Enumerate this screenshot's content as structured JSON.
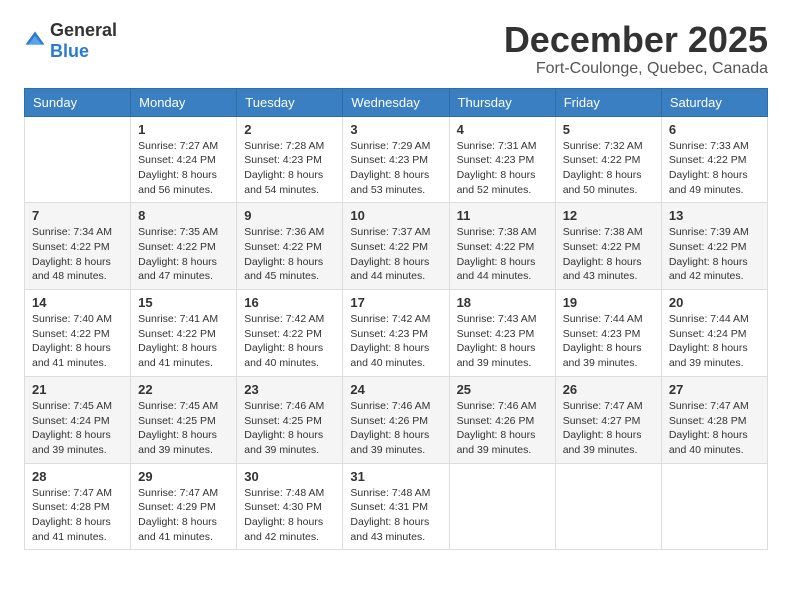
{
  "logo": {
    "general": "General",
    "blue": "Blue"
  },
  "header": {
    "month": "December 2025",
    "location": "Fort-Coulonge, Quebec, Canada"
  },
  "weekdays": [
    "Sunday",
    "Monday",
    "Tuesday",
    "Wednesday",
    "Thursday",
    "Friday",
    "Saturday"
  ],
  "weeks": [
    [
      {
        "day": "",
        "info": ""
      },
      {
        "day": "1",
        "info": "Sunrise: 7:27 AM\nSunset: 4:24 PM\nDaylight: 8 hours\nand 56 minutes."
      },
      {
        "day": "2",
        "info": "Sunrise: 7:28 AM\nSunset: 4:23 PM\nDaylight: 8 hours\nand 54 minutes."
      },
      {
        "day": "3",
        "info": "Sunrise: 7:29 AM\nSunset: 4:23 PM\nDaylight: 8 hours\nand 53 minutes."
      },
      {
        "day": "4",
        "info": "Sunrise: 7:31 AM\nSunset: 4:23 PM\nDaylight: 8 hours\nand 52 minutes."
      },
      {
        "day": "5",
        "info": "Sunrise: 7:32 AM\nSunset: 4:22 PM\nDaylight: 8 hours\nand 50 minutes."
      },
      {
        "day": "6",
        "info": "Sunrise: 7:33 AM\nSunset: 4:22 PM\nDaylight: 8 hours\nand 49 minutes."
      }
    ],
    [
      {
        "day": "7",
        "info": "Sunrise: 7:34 AM\nSunset: 4:22 PM\nDaylight: 8 hours\nand 48 minutes."
      },
      {
        "day": "8",
        "info": "Sunrise: 7:35 AM\nSunset: 4:22 PM\nDaylight: 8 hours\nand 47 minutes."
      },
      {
        "day": "9",
        "info": "Sunrise: 7:36 AM\nSunset: 4:22 PM\nDaylight: 8 hours\nand 45 minutes."
      },
      {
        "day": "10",
        "info": "Sunrise: 7:37 AM\nSunset: 4:22 PM\nDaylight: 8 hours\nand 44 minutes."
      },
      {
        "day": "11",
        "info": "Sunrise: 7:38 AM\nSunset: 4:22 PM\nDaylight: 8 hours\nand 44 minutes."
      },
      {
        "day": "12",
        "info": "Sunrise: 7:38 AM\nSunset: 4:22 PM\nDaylight: 8 hours\nand 43 minutes."
      },
      {
        "day": "13",
        "info": "Sunrise: 7:39 AM\nSunset: 4:22 PM\nDaylight: 8 hours\nand 42 minutes."
      }
    ],
    [
      {
        "day": "14",
        "info": "Sunrise: 7:40 AM\nSunset: 4:22 PM\nDaylight: 8 hours\nand 41 minutes."
      },
      {
        "day": "15",
        "info": "Sunrise: 7:41 AM\nSunset: 4:22 PM\nDaylight: 8 hours\nand 41 minutes."
      },
      {
        "day": "16",
        "info": "Sunrise: 7:42 AM\nSunset: 4:22 PM\nDaylight: 8 hours\nand 40 minutes."
      },
      {
        "day": "17",
        "info": "Sunrise: 7:42 AM\nSunset: 4:23 PM\nDaylight: 8 hours\nand 40 minutes."
      },
      {
        "day": "18",
        "info": "Sunrise: 7:43 AM\nSunset: 4:23 PM\nDaylight: 8 hours\nand 39 minutes."
      },
      {
        "day": "19",
        "info": "Sunrise: 7:44 AM\nSunset: 4:23 PM\nDaylight: 8 hours\nand 39 minutes."
      },
      {
        "day": "20",
        "info": "Sunrise: 7:44 AM\nSunset: 4:24 PM\nDaylight: 8 hours\nand 39 minutes."
      }
    ],
    [
      {
        "day": "21",
        "info": "Sunrise: 7:45 AM\nSunset: 4:24 PM\nDaylight: 8 hours\nand 39 minutes."
      },
      {
        "day": "22",
        "info": "Sunrise: 7:45 AM\nSunset: 4:25 PM\nDaylight: 8 hours\nand 39 minutes."
      },
      {
        "day": "23",
        "info": "Sunrise: 7:46 AM\nSunset: 4:25 PM\nDaylight: 8 hours\nand 39 minutes."
      },
      {
        "day": "24",
        "info": "Sunrise: 7:46 AM\nSunset: 4:26 PM\nDaylight: 8 hours\nand 39 minutes."
      },
      {
        "day": "25",
        "info": "Sunrise: 7:46 AM\nSunset: 4:26 PM\nDaylight: 8 hours\nand 39 minutes."
      },
      {
        "day": "26",
        "info": "Sunrise: 7:47 AM\nSunset: 4:27 PM\nDaylight: 8 hours\nand 39 minutes."
      },
      {
        "day": "27",
        "info": "Sunrise: 7:47 AM\nSunset: 4:28 PM\nDaylight: 8 hours\nand 40 minutes."
      }
    ],
    [
      {
        "day": "28",
        "info": "Sunrise: 7:47 AM\nSunset: 4:28 PM\nDaylight: 8 hours\nand 41 minutes."
      },
      {
        "day": "29",
        "info": "Sunrise: 7:47 AM\nSunset: 4:29 PM\nDaylight: 8 hours\nand 41 minutes."
      },
      {
        "day": "30",
        "info": "Sunrise: 7:48 AM\nSunset: 4:30 PM\nDaylight: 8 hours\nand 42 minutes."
      },
      {
        "day": "31",
        "info": "Sunrise: 7:48 AM\nSunset: 4:31 PM\nDaylight: 8 hours\nand 43 minutes."
      },
      {
        "day": "",
        "info": ""
      },
      {
        "day": "",
        "info": ""
      },
      {
        "day": "",
        "info": ""
      }
    ]
  ]
}
